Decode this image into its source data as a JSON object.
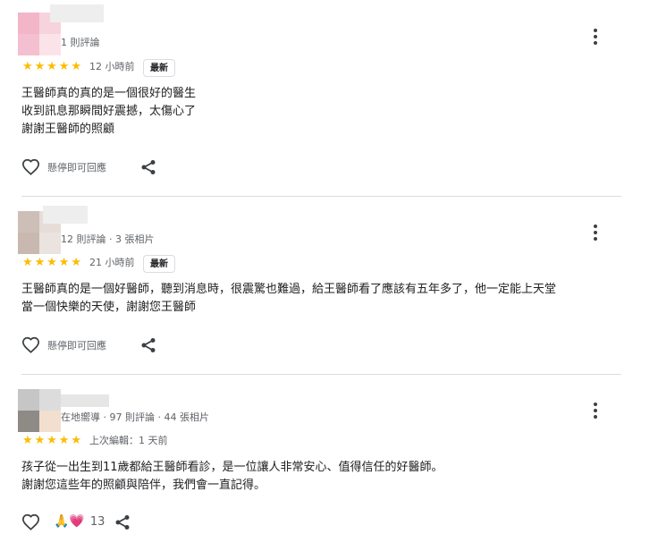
{
  "reviews": [
    {
      "meta": "1 則評論",
      "rating": 5,
      "time": "12 小時前",
      "badge": "最新",
      "text_lines": [
        "王醫師真的真的是一個很好的醫生",
        "收到訊息那瞬間好震撼，太傷心了",
        "謝謝王醫師的照顧"
      ],
      "like_label": "懸停即可回應"
    },
    {
      "meta": "12 則評論 · 3 張相片",
      "rating": 5,
      "time": "21 小時前",
      "badge": "最新",
      "text_lines": [
        "王醫師真的是一個好醫師，聽到消息時，很震驚也難過，給王醫師看了應該有五年多了，他一定能上天堂",
        "當一個快樂的天使，謝謝您王醫師"
      ],
      "like_label": "懸停即可回應"
    },
    {
      "meta": "在地嚮導 · 97 則評論 · 44 張相片",
      "rating": 5,
      "time": "上次編輯：1 天前",
      "text_lines": [
        "孩子從一出生到11歲都給王醫師看診，是一位讓人非常安心、值得信任的好醫師。",
        "謝謝您這些年的照顧與陪伴，我們會一直記得。"
      ],
      "reaction_emoji": "🙏💗",
      "reaction_count": "13"
    }
  ],
  "icons": {
    "star": "star-icon",
    "more": "more-vert-icon",
    "like": "heart-outline-icon",
    "share": "share-icon"
  },
  "colors": {
    "star": "#fbbc04",
    "text": "#202124",
    "muted": "#5f6368",
    "divider": "#dadce0"
  }
}
